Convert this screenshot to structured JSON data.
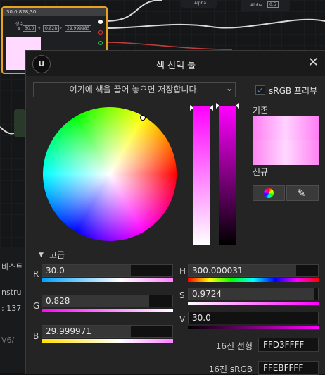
{
  "graph": {
    "node_title": "30,0.828,30",
    "node_const_label": "상수",
    "node_x": "X",
    "node_x_value": "30.0",
    "node_y": "Y",
    "node_y_value": "0.828",
    "node_z": "Z",
    "node_z_value": "29.999985",
    "alpha_pin_1": "Alpha",
    "alpha_pin_2": "Alpha",
    "alpha_value": "0.5",
    "side_text_1": "비스트",
    "side_text_2": "nstru",
    "side_text_3": ": 137",
    "side_text_4": "V6/"
  },
  "dialog": {
    "title": "색 선택 툴",
    "close_glyph": "✕",
    "logo_glyph": "U",
    "drop_zone_text": "여기에 색을 끌어 놓으면 저장합니다.",
    "srgb_preview_label": "sRGB 프리뷰",
    "srgb_checked_glyph": "✓",
    "old_label": "기존",
    "new_label": "신규",
    "advanced_label": "고급",
    "advanced_arrow": "▼",
    "dropdown_arrow": "⌄",
    "dropper_glyph": "✎"
  },
  "channels": {
    "r_label": "R",
    "r_value": "30.0",
    "r_fill": 0.68,
    "g_label": "G",
    "g_value": "0.828",
    "g_fill": 0.82,
    "b_label": "B",
    "b_value": "29.999971",
    "b_fill": 0.68,
    "h_label": "H",
    "h_value": "300.000031",
    "h_fill": 0.83,
    "s_label": "S",
    "s_value": "0.9724",
    "s_fill": 0.97,
    "v_label": "V",
    "v_value": "30.0",
    "v_fill": 0.0
  },
  "hex": {
    "linear_label": "16진 선형",
    "linear_value": "FFD3FFFF",
    "srgb_label": "16진 sRGB",
    "srgb_value": "FFEBFFFF"
  },
  "colors": {
    "accent": "#ff00ff",
    "selection": "#e8a221",
    "checkbox": "#2e8cf0"
  }
}
